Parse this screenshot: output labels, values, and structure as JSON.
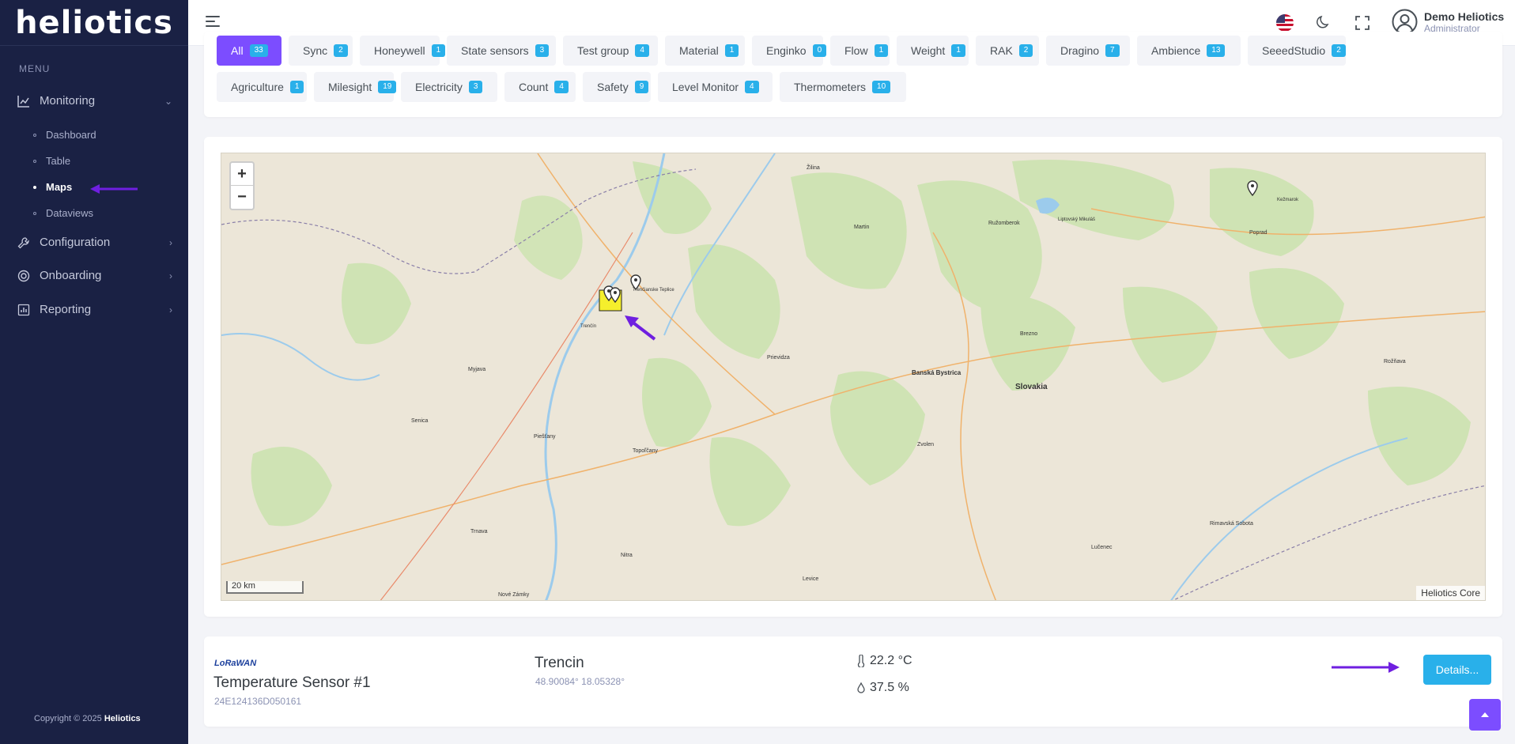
{
  "app": {
    "logo": "heliotics"
  },
  "sidebar": {
    "menu_label": "MENU",
    "items": [
      {
        "label": "Monitoring",
        "icon": "chart-line-icon"
      },
      {
        "label": "Configuration",
        "icon": "wrench-icon"
      },
      {
        "label": "Onboarding",
        "icon": "target-icon"
      },
      {
        "label": "Reporting",
        "icon": "report-chart-icon"
      }
    ],
    "monitoring_sub": [
      "Dashboard",
      "Table",
      "Maps",
      "Dataviews"
    ],
    "active_sub": "Maps",
    "copyright_prefix": "Copyright © 2025",
    "copyright_brand": "Heliotics"
  },
  "header": {
    "user_name": "Demo Heliotics",
    "user_role": "Administrator"
  },
  "filters": [
    {
      "label": "All",
      "count": "33"
    },
    {
      "label": "Sync",
      "count": "2"
    },
    {
      "label": "Honeywell",
      "count": "1"
    },
    {
      "label": "State sensors",
      "count": "3"
    },
    {
      "label": "Test group",
      "count": "4"
    },
    {
      "label": "Material",
      "count": "1"
    },
    {
      "label": "Enginko",
      "count": "0"
    },
    {
      "label": "Flow",
      "count": "1"
    },
    {
      "label": "Weight",
      "count": "1"
    },
    {
      "label": "RAK",
      "count": "2"
    },
    {
      "label": "Dragino",
      "count": "7"
    },
    {
      "label": "Ambience",
      "count": "13"
    },
    {
      "label": "SeeedStudio",
      "count": "2"
    },
    {
      "label": "Agriculture",
      "count": "1"
    },
    {
      "label": "Milesight",
      "count": "19"
    },
    {
      "label": "Electricity",
      "count": "3"
    },
    {
      "label": "Count",
      "count": "4"
    },
    {
      "label": "Safety",
      "count": "9"
    },
    {
      "label": "Level Monitor",
      "count": "4"
    },
    {
      "label": "Thermometers",
      "count": "10"
    }
  ],
  "map": {
    "zoom_in": "+",
    "zoom_out": "−",
    "scale_label": "20 km",
    "attribution": "Heliotics Core",
    "labels": {
      "region": "Slovakia",
      "city1": "Banská Bystrica",
      "city2": "Trenčianske Teplice",
      "city3": "Trenčín",
      "city4": "Nitra",
      "city5": "Žilina",
      "city6": "Poprad",
      "city7": "Prievidza",
      "city8": "Martin",
      "city9": "Ružomberok",
      "city10": "Liptovský Mikuláš",
      "city11": "Zvolen",
      "city12": "Lučenec",
      "city13": "Rimavská Sobota",
      "city14": "Levice",
      "city15": "Topoľčany",
      "city16": "Nové Zámky",
      "city17": "Piešťany",
      "city18": "Trnava",
      "city19": "Senica",
      "city20": "Myjava",
      "city21": "Kežmarok",
      "city22": "Rožňava",
      "city23": "Brezno"
    }
  },
  "device": {
    "network": "LoRaWAN",
    "title": "Temperature Sensor #1",
    "id": "24E124136D050161",
    "location": "Trencin",
    "coords": "48.90084° 18.05328°",
    "temperature": "22.2 °C",
    "humidity": "37.5 %",
    "details_label": "Details..."
  },
  "colors": {
    "accent": "#7c4dff",
    "badge": "#29b0ea",
    "sidebar": "#1a2144"
  }
}
